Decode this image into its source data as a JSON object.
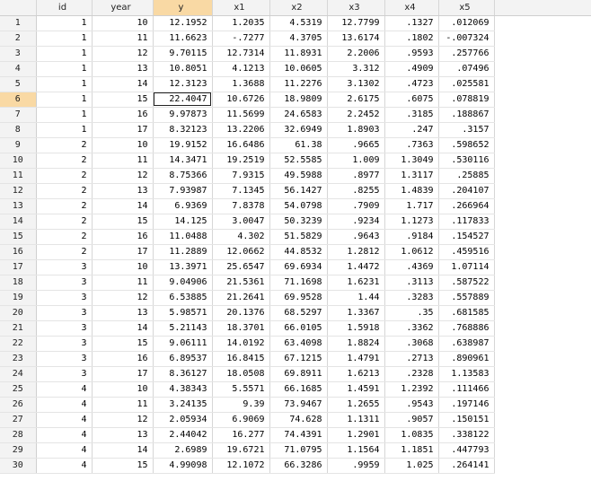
{
  "columns": [
    "",
    "id",
    "year",
    "y",
    "x1",
    "x2",
    "x3",
    "x4",
    "x5"
  ],
  "selected_column": "y",
  "current_row": 6,
  "rows": [
    [
      "1",
      "1",
      "10",
      "12.1952",
      "1.2035",
      "4.5319",
      "12.7799",
      ".1327",
      ".012069"
    ],
    [
      "2",
      "1",
      "11",
      "11.6623",
      "-.7277",
      "4.3705",
      "13.6174",
      ".1802",
      "-.007324"
    ],
    [
      "3",
      "1",
      "12",
      "9.70115",
      "12.7314",
      "11.8931",
      "2.2006",
      ".9593",
      ".257766"
    ],
    [
      "4",
      "1",
      "13",
      "10.8051",
      "4.1213",
      "10.0605",
      "3.312",
      ".4909",
      ".07496"
    ],
    [
      "5",
      "1",
      "14",
      "12.3123",
      "1.3688",
      "11.2276",
      "3.1302",
      ".4723",
      ".025581"
    ],
    [
      "6",
      "1",
      "15",
      "22.4047",
      "10.6726",
      "18.9809",
      "2.6175",
      ".6075",
      ".078819"
    ],
    [
      "7",
      "1",
      "16",
      "9.97873",
      "11.5699",
      "24.6583",
      "2.2452",
      ".3185",
      ".188867"
    ],
    [
      "8",
      "1",
      "17",
      "8.32123",
      "13.2206",
      "32.6949",
      "1.8903",
      ".247",
      ".3157"
    ],
    [
      "9",
      "2",
      "10",
      "19.9152",
      "16.6486",
      "61.38",
      ".9665",
      ".7363",
      ".598652"
    ],
    [
      "10",
      "2",
      "11",
      "14.3471",
      "19.2519",
      "52.5585",
      "1.009",
      "1.3049",
      ".530116"
    ],
    [
      "11",
      "2",
      "12",
      "8.75366",
      "7.9315",
      "49.5988",
      ".8977",
      "1.3117",
      ".25885"
    ],
    [
      "12",
      "2",
      "13",
      "7.93987",
      "7.1345",
      "56.1427",
      ".8255",
      "1.4839",
      ".204107"
    ],
    [
      "13",
      "2",
      "14",
      "6.9369",
      "7.8378",
      "54.0798",
      ".7909",
      "1.717",
      ".266964"
    ],
    [
      "14",
      "2",
      "15",
      "14.125",
      "3.0047",
      "50.3239",
      ".9234",
      "1.1273",
      ".117833"
    ],
    [
      "15",
      "2",
      "16",
      "11.0488",
      "4.302",
      "51.5829",
      ".9643",
      ".9184",
      ".154527"
    ],
    [
      "16",
      "2",
      "17",
      "11.2889",
      "12.0662",
      "44.8532",
      "1.2812",
      "1.0612",
      ".459516"
    ],
    [
      "17",
      "3",
      "10",
      "13.3971",
      "25.6547",
      "69.6934",
      "1.4472",
      ".4369",
      "1.07114"
    ],
    [
      "18",
      "3",
      "11",
      "9.04906",
      "21.5361",
      "71.1698",
      "1.6231",
      ".3113",
      ".587522"
    ],
    [
      "19",
      "3",
      "12",
      "6.53885",
      "21.2641",
      "69.9528",
      "1.44",
      ".3283",
      ".557889"
    ],
    [
      "20",
      "3",
      "13",
      "5.98571",
      "20.1376",
      "68.5297",
      "1.3367",
      ".35",
      ".681585"
    ],
    [
      "21",
      "3",
      "14",
      "5.21143",
      "18.3701",
      "66.0105",
      "1.5918",
      ".3362",
      ".768886"
    ],
    [
      "22",
      "3",
      "15",
      "9.06111",
      "14.0192",
      "63.4098",
      "1.8824",
      ".3068",
      ".638987"
    ],
    [
      "23",
      "3",
      "16",
      "6.89537",
      "16.8415",
      "67.1215",
      "1.4791",
      ".2713",
      ".890961"
    ],
    [
      "24",
      "3",
      "17",
      "8.36127",
      "18.0508",
      "69.8911",
      "1.6213",
      ".2328",
      "1.13583"
    ],
    [
      "25",
      "4",
      "10",
      "4.38343",
      "5.5571",
      "66.1685",
      "1.4591",
      "1.2392",
      ".111466"
    ],
    [
      "26",
      "4",
      "11",
      "3.24135",
      "9.39",
      "73.9467",
      "1.2655",
      ".9543",
      ".197146"
    ],
    [
      "27",
      "4",
      "12",
      "2.05934",
      "6.9069",
      "74.628",
      "1.1311",
      ".9057",
      ".150151"
    ],
    [
      "28",
      "4",
      "13",
      "2.44042",
      "16.277",
      "74.4391",
      "1.2901",
      "1.0835",
      ".338122"
    ],
    [
      "29",
      "4",
      "14",
      "2.6989",
      "19.6721",
      "71.0795",
      "1.1564",
      "1.1851",
      ".447793"
    ],
    [
      "30",
      "4",
      "15",
      "4.99098",
      "12.1072",
      "66.3286",
      ".9959",
      "1.025",
      ".264141"
    ]
  ]
}
